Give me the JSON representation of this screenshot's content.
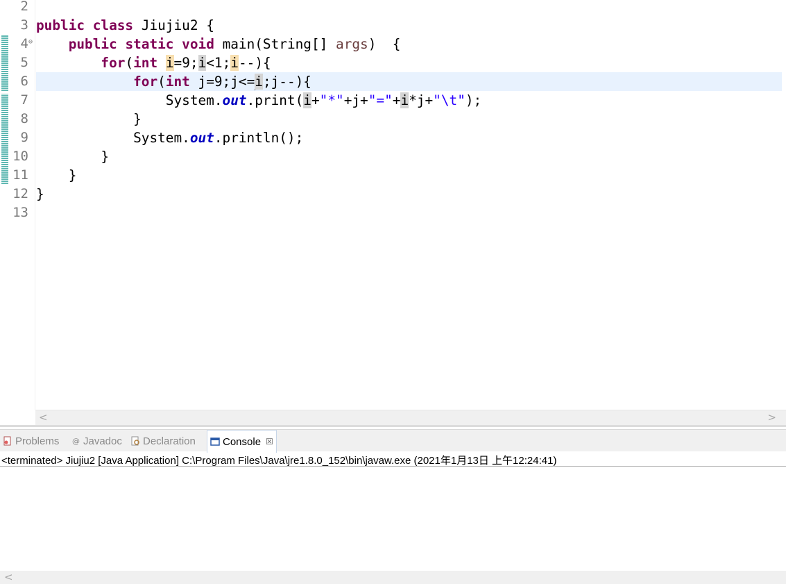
{
  "editor": {
    "line_numbers": [
      "2",
      "3",
      "4",
      "5",
      "6",
      "7",
      "8",
      "9",
      "10",
      "11",
      "12",
      "13"
    ],
    "fold_marker": "⊖",
    "code": {
      "l3": [
        "public",
        "class",
        "Jiujiu2 {"
      ],
      "l4": [
        "public",
        "static",
        "void",
        "main(String[] ",
        "args",
        ")  {"
      ],
      "l5": [
        "for",
        "(",
        "int",
        "i",
        "=9;",
        "i",
        "<1;",
        "i",
        "--){"
      ],
      "l6": [
        "for",
        "(",
        "int",
        " j=9;j<=",
        "i",
        ";j--){"
      ],
      "l7": [
        "System.",
        "out",
        ".print(",
        "i",
        "+",
        "\"*\"",
        "+j+",
        "\"=\"",
        "+",
        "i",
        "*j+",
        "\"\\t\"",
        ");"
      ],
      "l8": [
        "}"
      ],
      "l9": [
        "System.",
        "out",
        ".println();"
      ],
      "l10": [
        "}"
      ],
      "l11": [
        "}"
      ],
      "l12": [
        "}"
      ]
    }
  },
  "panel": {
    "tabs": [
      {
        "label": "Problems",
        "icon": "problems-icon"
      },
      {
        "label": "Javadoc",
        "icon": "javadoc-icon"
      },
      {
        "label": "Declaration",
        "icon": "declaration-icon"
      },
      {
        "label": "Console",
        "icon": "console-icon",
        "active": true
      }
    ],
    "close_glyph": "☒",
    "status": "<terminated> Jiujiu2 [Java Application] C:\\Program Files\\Java\\jre1.8.0_152\\bin\\javaw.exe (2021年1月13日 上午12:24:41)"
  },
  "scroll": {
    "left_arrow": "<",
    "right_arrow": ">"
  },
  "colors": {
    "keyword": "#7f0055",
    "string": "#2a00ff",
    "field": "#0000c0",
    "current_line": "#e8f2fe",
    "occurrence_write": "#f8dfb0",
    "occurrence_read": "#d4d4d4"
  }
}
